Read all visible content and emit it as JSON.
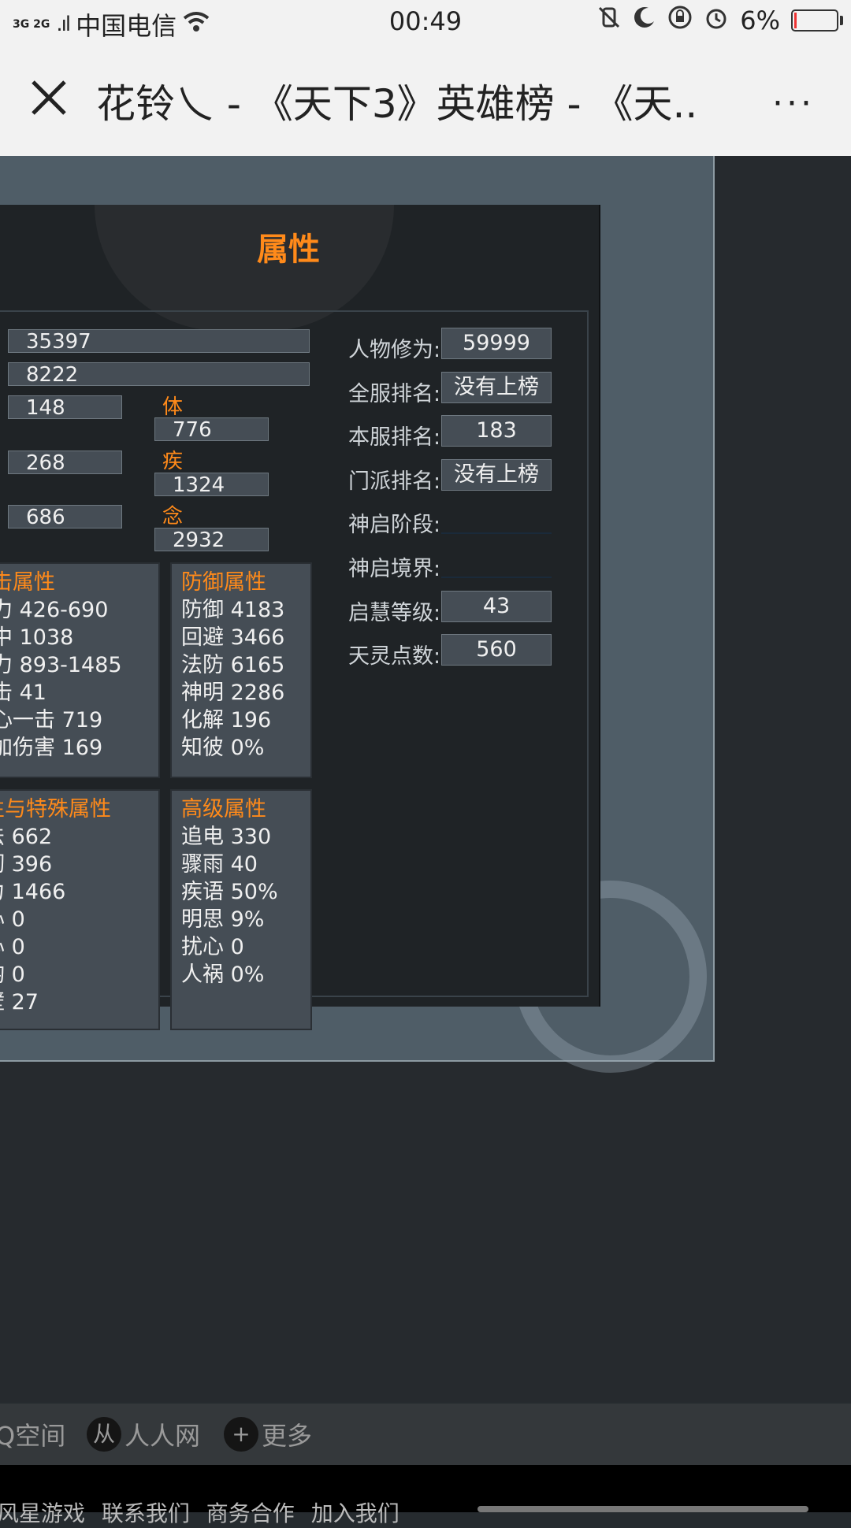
{
  "status_bar": {
    "network": "3G 2G",
    "carrier": "中国电信",
    "time": "00:49",
    "battery": "6%",
    "battery_level": 0.06
  },
  "title_bar": {
    "title": "花铃乀 - 《天下3》英雄榜 - 《天...",
    "more": "···"
  },
  "panel": {
    "title": "属性",
    "fields": {
      "f1": "35397",
      "f2": "8222",
      "f3": "148",
      "f4": "268",
      "f5": "686"
    },
    "stats": [
      {
        "label": "体",
        "value": "776"
      },
      {
        "label": "疾",
        "value": "1324"
      },
      {
        "label": "念",
        "value": "2932"
      }
    ],
    "attack_box": {
      "header": "攻击属性",
      "rows": [
        {
          "label": "攻力",
          "value": "426-690"
        },
        {
          "label": "命中",
          "value": "1038"
        },
        {
          "label": "法力",
          "value": "893-1485"
        },
        {
          "label": "会击",
          "value": "41"
        },
        {
          "label": "会心一击",
          "value": "719"
        },
        {
          "label": "附加伤害",
          "value": "169"
        }
      ]
    },
    "defense_box": {
      "header": "防御属性",
      "rows": [
        {
          "label": "防御",
          "value": "4183"
        },
        {
          "label": "回避",
          "value": "3466"
        },
        {
          "label": "法防",
          "value": "6165"
        },
        {
          "label": "神明",
          "value": "2286"
        },
        {
          "label": "化解",
          "value": "196"
        },
        {
          "label": "知彼",
          "value": "0%"
        }
      ]
    },
    "special_box": {
      "header": "抗性与特殊属性",
      "rows": [
        {
          "label": "破法",
          "value": "662"
        },
        {
          "label": "坚韧",
          "value": "396"
        },
        {
          "label": "定力",
          "value": "1466"
        },
        {
          "label": "诛心",
          "value": "0"
        },
        {
          "label": "御心",
          "value": "0"
        },
        {
          "label": "万钧",
          "value": "0"
        },
        {
          "label": "铁壁",
          "value": "27"
        }
      ]
    },
    "advanced_box": {
      "header": "高级属性",
      "rows": [
        {
          "label": "追电",
          "value": "330"
        },
        {
          "label": "骤雨",
          "value": "40"
        },
        {
          "label": "疾语",
          "value": "50%"
        },
        {
          "label": "明思",
          "value": "9%"
        },
        {
          "label": "扰心",
          "value": "0"
        },
        {
          "label": "人祸",
          "value": "0%"
        }
      ]
    },
    "right_info": [
      {
        "label": "人物修为:",
        "value": "59999"
      },
      {
        "label": "全服排名:",
        "value": "没有上榜"
      },
      {
        "label": "本服排名:",
        "value": "183"
      },
      {
        "label": "门派排名:",
        "value": "没有上榜"
      },
      {
        "label": "神启阶段:",
        "value": ""
      },
      {
        "label": "神启境界:",
        "value": ""
      },
      {
        "label": "启慧等级:",
        "value": "43"
      },
      {
        "label": "天灵点数:",
        "value": "560"
      }
    ]
  },
  "share_bar": {
    "items": [
      {
        "label": "Q空间"
      },
      {
        "label": "人人网"
      },
      {
        "label": "更多"
      }
    ]
  },
  "footer": {
    "links": "风星游戏  联系我们  商务合作  加入我们"
  }
}
